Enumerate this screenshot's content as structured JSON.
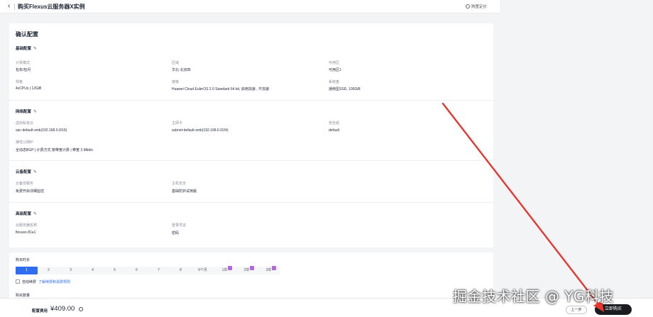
{
  "header": {
    "back_icon": "chevron-left-icon",
    "title": "购买Flexus云服务器X实例",
    "price_link": "购置定价"
  },
  "page_title": "确认配置",
  "sections": [
    {
      "title": "基础配置",
      "fields": [
        {
          "label": "计费模式",
          "value": "包年/包月"
        },
        {
          "label": "区域",
          "value": "华北-北京四"
        },
        {
          "label": "可用区",
          "value": "可用区1"
        },
        {
          "label": "规格",
          "value": "4vCPUs | 12GiB"
        },
        {
          "label": "镜像",
          "value": "Huawei Cloud EulerOS 2.0 Standard 64 bit, 启用加速 , 不加速"
        },
        {
          "label": "系统盘",
          "value": "通用型SSD, 100GiB"
        }
      ]
    },
    {
      "title": "网络配置",
      "fields": [
        {
          "label": "虚拟私有云",
          "value": "vpc-default-smb(192.168.0.0/16)"
        },
        {
          "label": "主网卡",
          "value": "subnet-default-smb(192.168.0.0/24)"
        },
        {
          "label": "安全组",
          "value": "default"
        },
        {
          "label": "弹性公网IP",
          "value": "全动态BGP | 计费方式 按带宽计费 | 带宽 3 Mbit/s"
        }
      ]
    },
    {
      "title": "云备配置",
      "fields": [
        {
          "label": "云备份服务",
          "value": "免费开启详细监控"
        },
        {
          "label": "主机安全",
          "value": "基础防护试用版"
        }
      ]
    },
    {
      "title": "高级配置",
      "fields": [
        {
          "label": "云服务器名称",
          "value": "flexusx-81a1"
        },
        {
          "label": "登录凭证",
          "value": "密码"
        }
      ]
    }
  ],
  "purchase": {
    "duration_title": "购买时长",
    "durations": [
      "1",
      "2",
      "3",
      "4",
      "5",
      "6",
      "7",
      "8",
      "9个月",
      "1年",
      "2年",
      "3年"
    ],
    "selected_index": 0,
    "auto_renew_label": "自动续费",
    "auto_renew_link": "了解续费和退费规则",
    "quantity_title": "购买数量"
  },
  "footer": {
    "fee_label": "配置费用",
    "fee_value": "¥409.00",
    "prev_label": "上一步",
    "buy_label": "立即购买"
  },
  "watermark": "掘金技术社区 @ YG科技",
  "colors": {
    "accent": "#2f6df0",
    "badge": "#b366e0",
    "buy_button": "#1b1c1f",
    "annotation_arrow": "#e8362f"
  }
}
